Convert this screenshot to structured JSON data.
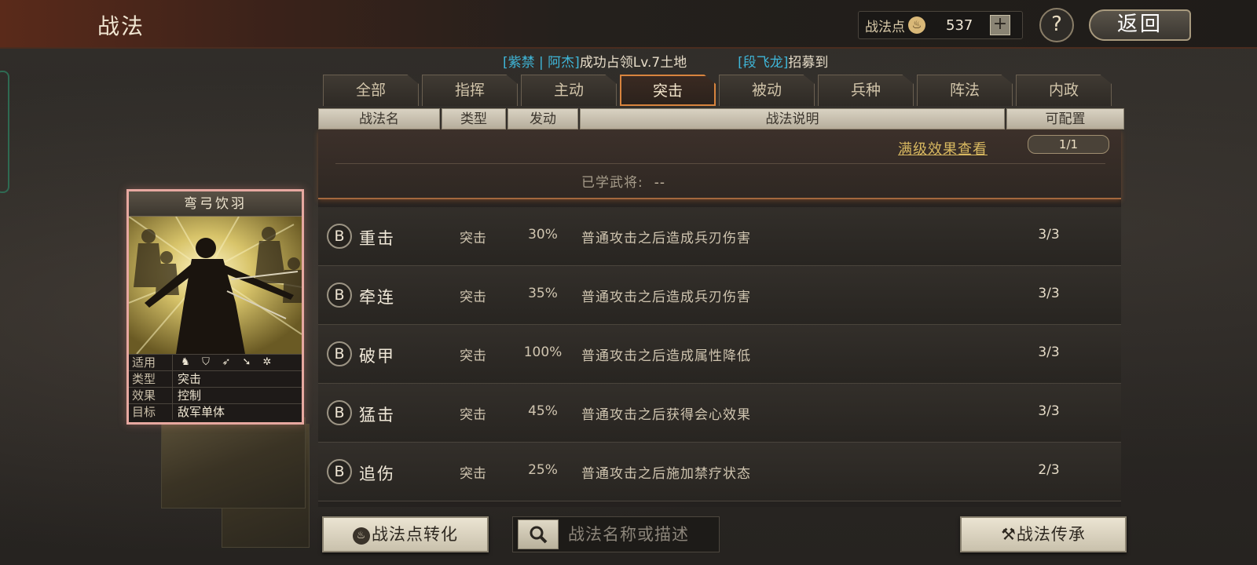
{
  "header": {
    "title": "战法",
    "points_label": "战法点",
    "points_icon": "flame-icon",
    "points_value": "537",
    "plus_label": "+",
    "help_label": "?",
    "back_label": "返回"
  },
  "ticker": {
    "msg1_tag": "[紫禁 | 阿杰]",
    "msg1_text": "成功占领Lv.7土地",
    "msg2_tag": "[段飞龙]",
    "msg2_text": "招募到"
  },
  "tabs": [
    "全部",
    "指挥",
    "主动",
    "突击",
    "被动",
    "兵种",
    "阵法",
    "内政"
  ],
  "active_tab": "突击",
  "columns": {
    "name": "战法名",
    "type": "类型",
    "trigger": "发动",
    "description": "战法说明",
    "configurable": "可配置"
  },
  "detail": {
    "full_effect_link": "满级效果查看",
    "config_count": "1/1",
    "learned_label": "已学武将:",
    "learned_value": "--"
  },
  "skills": [
    {
      "grade": "B",
      "name": "重击",
      "type": "突击",
      "rate": "30%",
      "desc": "普通攻击之后造成兵刃伤害",
      "config": "3/3"
    },
    {
      "grade": "B",
      "name": "牵连",
      "type": "突击",
      "rate": "35%",
      "desc": "普通攻击之后造成兵刃伤害",
      "config": "3/3"
    },
    {
      "grade": "B",
      "name": "破甲",
      "type": "突击",
      "rate": "100%",
      "desc": "普通攻击之后造成属性降低",
      "config": "3/3"
    },
    {
      "grade": "B",
      "name": "猛击",
      "type": "突击",
      "rate": "45%",
      "desc": "普通攻击之后获得会心效果",
      "config": "3/3"
    },
    {
      "grade": "B",
      "name": "追伤",
      "type": "突击",
      "rate": "25%",
      "desc": "普通攻击之后施加禁疗状态",
      "config": "2/3"
    }
  ],
  "card": {
    "title": "弯弓饮羽",
    "applicable_label": "适用",
    "applicable_icons": [
      "cavalry-icon",
      "shield-icon",
      "bow-icon",
      "spear-icon",
      "wheel-icon"
    ],
    "type_label": "类型",
    "type_value": "突击",
    "effect_label": "效果",
    "effect_value": "控制",
    "target_label": "目标",
    "target_value": "敌军单体"
  },
  "bottom": {
    "convert_label": "战法点转化",
    "search_placeholder": "战法名称或描述",
    "inherit_label": "战法传承"
  },
  "colors": {
    "accent_orange": "#d8843e",
    "ticker_cyan": "#3fb6d8",
    "link_gold": "#d8b860",
    "card_border": "#e7a8a0"
  }
}
